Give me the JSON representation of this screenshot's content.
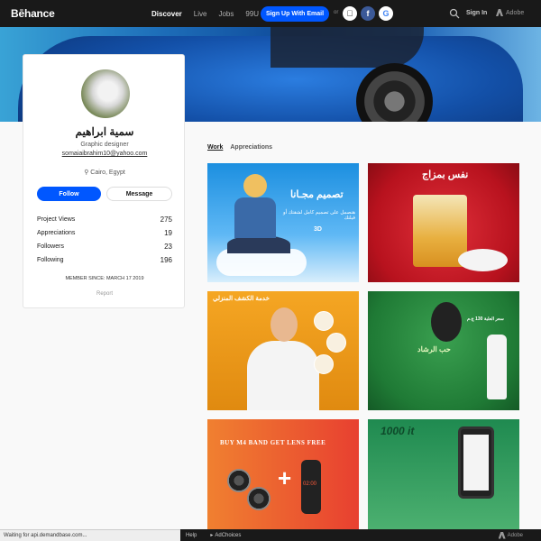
{
  "nav": {
    "logo": "Bēhance",
    "links": [
      "Discover",
      "Live",
      "Jobs",
      "99U"
    ],
    "signup_label": "Sign Up With Email",
    "or_label": "or",
    "signin_label": "Sign In",
    "adobe_label": "Adobe"
  },
  "profile": {
    "name": "سمية ابراهيم",
    "title": "Graphic designer",
    "email": "somaiaibrahim10@yahoo.com",
    "location": "Cairo, Egypt",
    "follow_label": "Follow",
    "message_label": "Message",
    "stats": [
      {
        "label": "Project Views",
        "value": "275"
      },
      {
        "label": "Appreciations",
        "value": "19"
      },
      {
        "label": "Followers",
        "value": "23"
      },
      {
        "label": "Following",
        "value": "196"
      }
    ],
    "member_since": "MEMBER SINCE: MARCH 17 2019",
    "report_label": "Report"
  },
  "tabs": {
    "work": "Work",
    "appreciations": "Appreciations"
  },
  "projects": {
    "p1_heading": "تصميم مجـانا",
    "p1_sub": "هنصمل على تصميم كامل لشقتك أو فيلتك",
    "p1_tag": "3D",
    "p2_heading": "نفس بمزاج",
    "p3_heading": "خدمة الكشف المنزلي",
    "p4_heading": "حب الرشاد",
    "p4_price": "سعر العلبة 130 ج.م",
    "p5_heading": "BUY M4 BAND GET LENS FREE",
    "p5_watch": "02:00",
    "p6_heading": "1000 it"
  },
  "statusbar": {
    "text": "Waiting for api.demandbase.com..."
  },
  "footer": {
    "help": "Help",
    "adchoices": "AdChoices",
    "adobe": "Adobe"
  },
  "colors": {
    "brand_blue": "#0057ff",
    "nav_bg": "#191919"
  }
}
